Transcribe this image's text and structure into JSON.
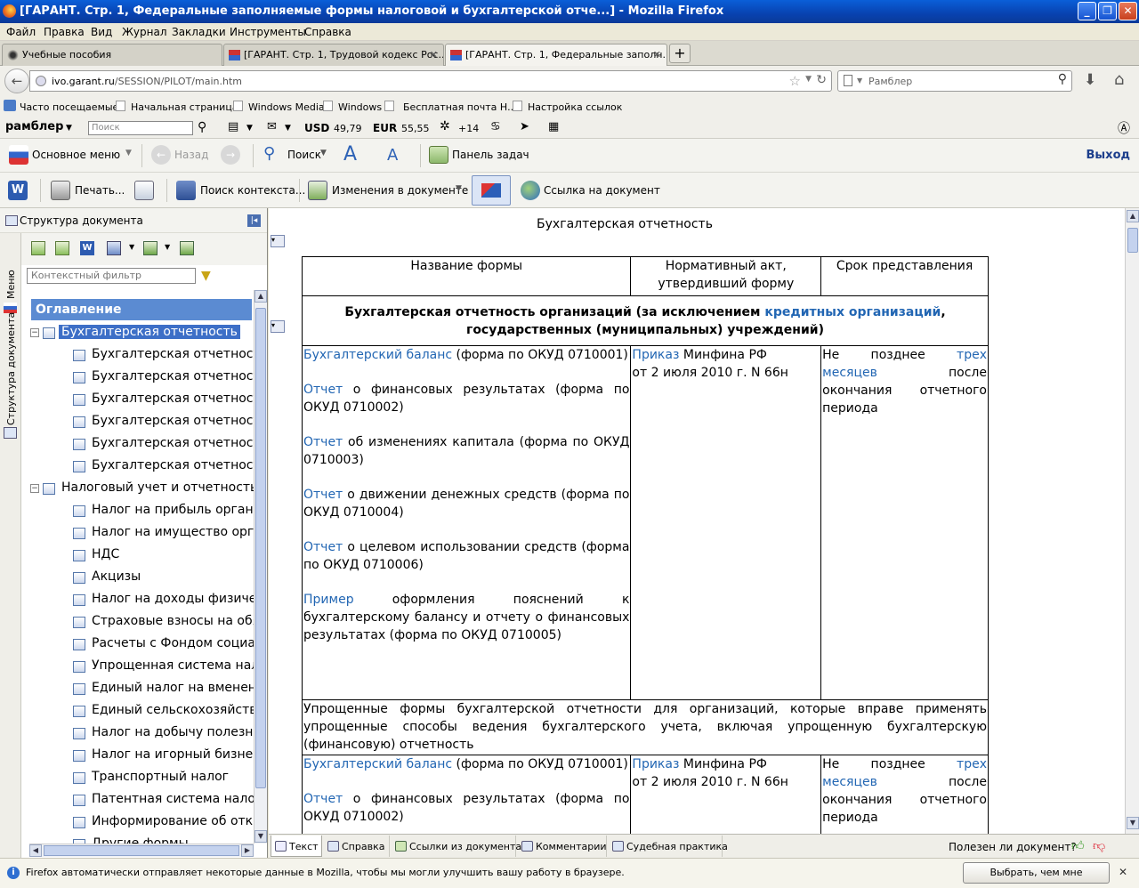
{
  "window": {
    "title": "[ГАРАНТ. Стр. 1, Федеральные заполняемые формы налоговой и бухгалтерской отче...] - Mozilla Firefox"
  },
  "menu": [
    "Файл",
    "Правка",
    "Вид",
    "Журнал",
    "Закладки",
    "Инструменты",
    "Справка"
  ],
  "tabs": [
    {
      "label": "Учебные пособия"
    },
    {
      "label": "[ГАРАНТ. Стр. 1, Трудовой кодекс Рос..."
    },
    {
      "label": "[ГАРАНТ. Стр. 1, Федеральные заполн..."
    }
  ],
  "nav": {
    "url_host": "ivo.garant.ru",
    "url_path": "/SESSION/PILOT/main.htm",
    "search_placeholder": "Рамблер"
  },
  "bookmarks": [
    "Часто посещаемые",
    "Начальная страница",
    "Windows Media",
    "Windows",
    "Бесплатная почта Н...",
    "Настройка ссылок"
  ],
  "rambler": {
    "logo": "рамблер",
    "search_placeholder": "Поиск",
    "usd_label": "USD",
    "usd_value": "49,79",
    "eur_label": "EUR",
    "eur_value": "55,55",
    "weather": "+14"
  },
  "toolbar1": {
    "main_menu": "Основное меню",
    "back": "Назад",
    "search": "Поиск",
    "taskbar": "Панель задач",
    "exit": "Выход"
  },
  "toolbar2": {
    "print": "Печать...",
    "context_search": "Поиск контекста...",
    "doc_changes": "Изменения в документе",
    "doc_link": "Ссылка на документ"
  },
  "leftpanel": {
    "header": "Структура документа",
    "vtab_menu": "Меню",
    "vtab_structure": "Структура документа",
    "filter_placeholder": "Контекстный фильтр",
    "toc_title": "Оглавление",
    "tree": [
      {
        "label": "Бухгалтерская отчетность",
        "level": 0,
        "expanded": true,
        "selected": true
      },
      {
        "label": "Бухгалтерская отчетность ор",
        "level": 1
      },
      {
        "label": "Бухгалтерская отчетность об",
        "level": 1
      },
      {
        "label": "Бухгалтерская отчетность ст",
        "level": 1
      },
      {
        "label": "Бухгалтерская отчетность не",
        "level": 1
      },
      {
        "label": "Бухгалтерская отчетность кр",
        "level": 1
      },
      {
        "label": "Бухгалтерская отчетность бі",
        "level": 1
      },
      {
        "label": "Налоговый учет и отчетность",
        "level": 0,
        "expanded": true
      },
      {
        "label": "Налог на прибыль организац",
        "level": 1
      },
      {
        "label": "Налог на имущество организ",
        "level": 1
      },
      {
        "label": "НДС",
        "level": 1
      },
      {
        "label": "Акцизы",
        "level": 1
      },
      {
        "label": "Налог на доходы физически",
        "level": 1
      },
      {
        "label": "Страховые взносы на обяза",
        "level": 1
      },
      {
        "label": "Расчеты с Фондом социальн",
        "level": 1
      },
      {
        "label": "Упрощенная система налого",
        "level": 1
      },
      {
        "label": "Единый налог на вмененный",
        "level": 1
      },
      {
        "label": "Единый сельскохозяйственн",
        "level": 1
      },
      {
        "label": "Налог на добычу полезных и",
        "level": 1
      },
      {
        "label": "Налог на игорный бизнес",
        "level": 1
      },
      {
        "label": "Транспортный налог",
        "level": 1
      },
      {
        "label": "Патентная система налогооб",
        "level": 1
      },
      {
        "label": "Информирование об открыт",
        "level": 1
      },
      {
        "label": "Другие формы",
        "level": 1
      }
    ]
  },
  "document": {
    "title": "Бухгалтерская отчетность",
    "headers": [
      "Название формы",
      "Нормативный акт, утвердивший форму",
      "Срок представления"
    ],
    "section1": {
      "text_a": "Бухгалтерская отчетность организаций (за исключением ",
      "link": "кредитных организаций",
      "text_b": ", государственных (муниципальных) учреждений)"
    },
    "forms1": [
      {
        "link": "Бухгалтерский баланс",
        "rest": " (форма по ОКУД 0710001)"
      },
      {
        "link": "Отчет",
        "rest": " о финансовых результатах (форма по ОКУД 0710002)"
      },
      {
        "link": "Отчет",
        "rest": " об изменениях капитала (форма по ОКУД 0710003)"
      },
      {
        "link": "Отчет",
        "rest": " о движении денежных средств (форма по ОКУД 0710004)"
      },
      {
        "link": "Отчет",
        "rest": " о целевом использовании средств (форма по ОКУД 0710006)"
      },
      {
        "link": "Пример",
        "rest": " оформления пояснений к бухгалтерскому балансу и отчету о финансовых результатах (форма по ОКУД 0710005)"
      }
    ],
    "act": {
      "link": "Приказ",
      "rest": " Минфина РФ",
      "line2": "от 2 июля 2010 г. N 66н"
    },
    "deadline": {
      "a": "Не позднее ",
      "link": "трех месяцев",
      "b": " после окончания отчетного периода"
    },
    "section2": "Упрощенные формы бухгалтерской отчетности для организаций, которые вправе применять упрощенные способы ведения бухгалтерского учета, включая упрощенную бухгалтерскую (финансовую) отчетность",
    "forms2": [
      {
        "link": "Бухгалтерский баланс",
        "rest": " (форма по ОКУД 0710001)"
      },
      {
        "link": "Отчет",
        "rest": " о финансовых результатах (форма по ОКУД 0710002)"
      }
    ]
  },
  "bottomtabs": [
    "Текст",
    "Справка",
    "Ссылки из документа",
    "Комментарии",
    "Судебная практика"
  ],
  "feedback": "Полезен ли документ?",
  "infobar": {
    "message": "Firefox автоматически отправляет некоторые данные в Mozilla, чтобы мы могли улучшить вашу работу в браузере.",
    "button": "Выбрать, чем мне поделиться"
  }
}
